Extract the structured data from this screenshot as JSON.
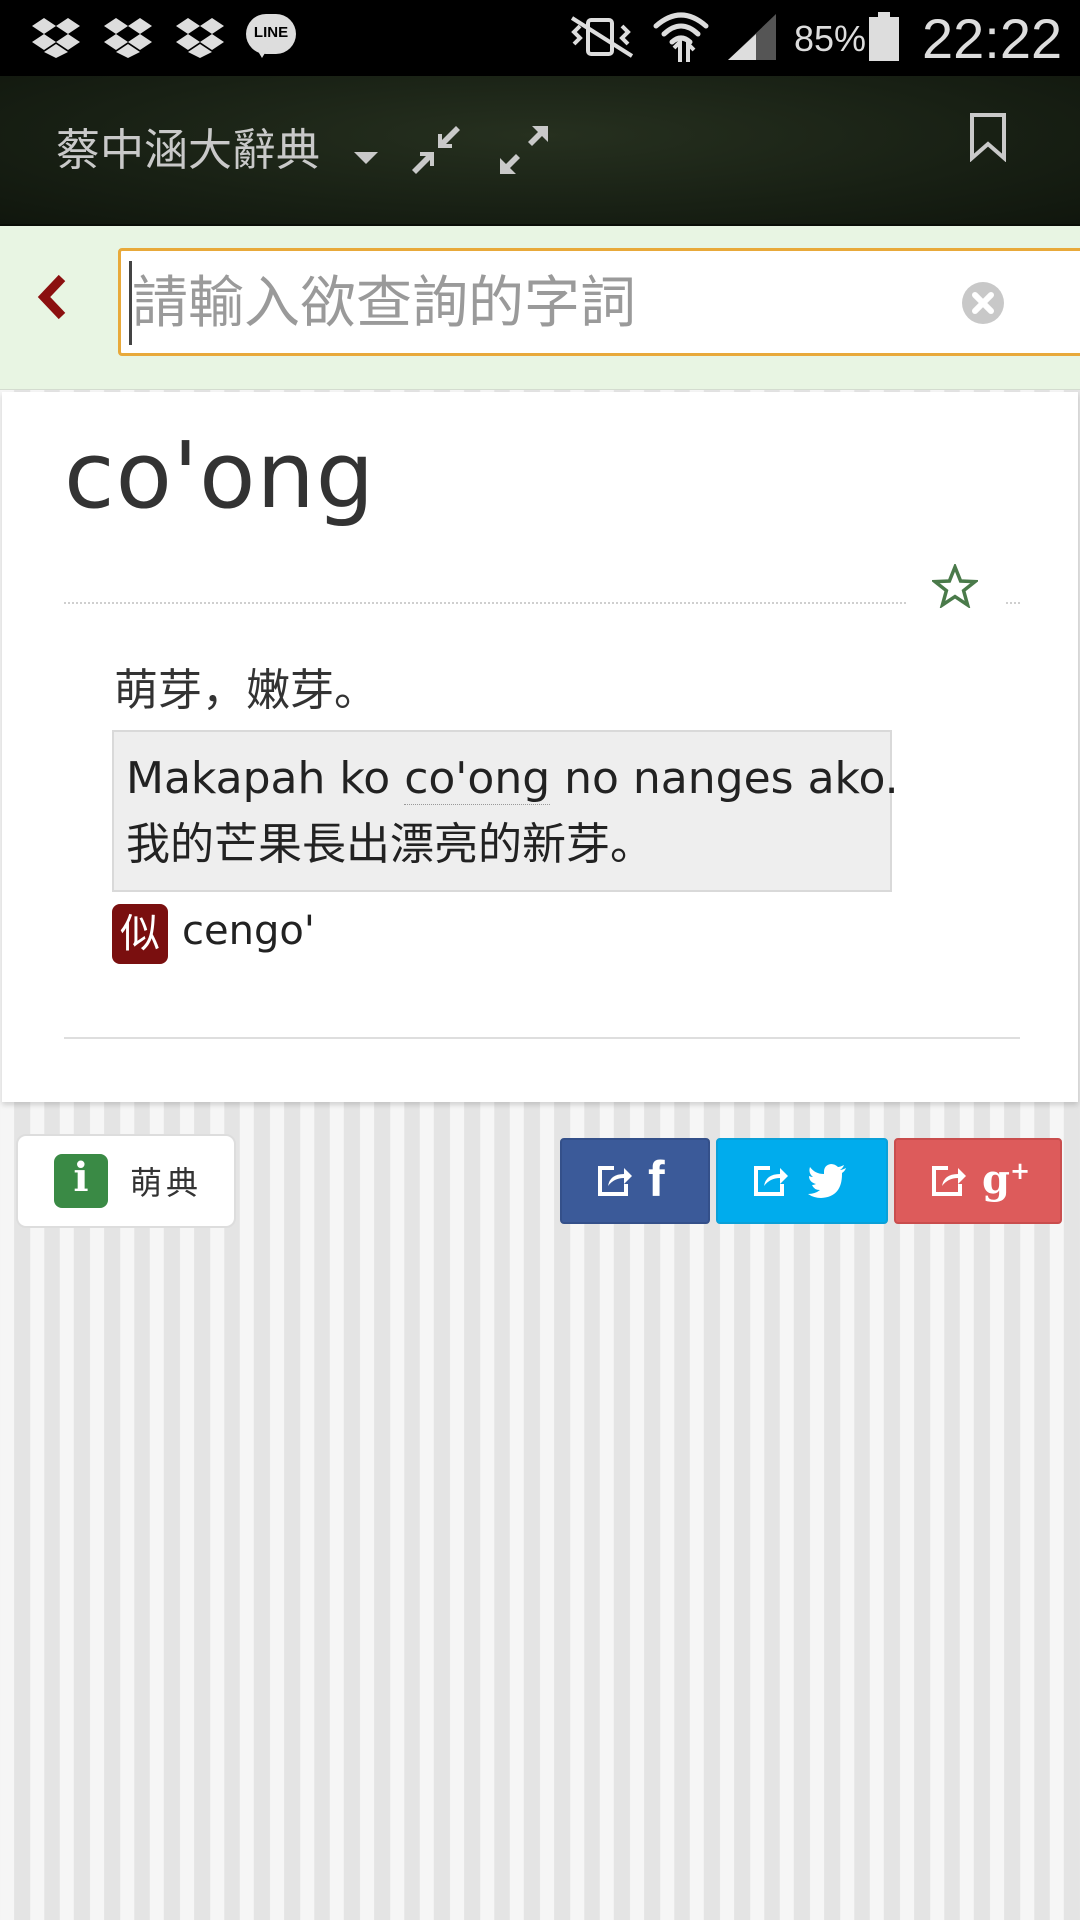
{
  "status_bar": {
    "battery_percent": "85%",
    "time": "22:22",
    "notification_icons": [
      "dropbox-icon",
      "dropbox-icon",
      "dropbox-icon",
      "line-icon"
    ],
    "line_label": "LINE"
  },
  "app_bar": {
    "title": "蔡中涵大辭典",
    "icons": [
      "dropdown-caret-icon",
      "compress-icon",
      "expand-icon",
      "bookmark-icon"
    ]
  },
  "search": {
    "placeholder": "請輸入欲查詢的字詞",
    "value": ""
  },
  "entry": {
    "headword": "co'ong",
    "definition": "萌芽，嫩芽。",
    "example": {
      "pre": "Makapah ko ",
      "highlight": "co'ong",
      "post": " no nanges ako.",
      "translation": "我的芒果長出漂亮的新芽。"
    },
    "synonym": {
      "badge": "似",
      "word": "cengo'"
    }
  },
  "footer": {
    "about_icon_letter": "i",
    "about_label": "萌典",
    "share": [
      "facebook",
      "twitter",
      "google-plus"
    ],
    "gp_label": "g",
    "gp_sup": "+",
    "fb_label": "f"
  },
  "colors": {
    "accent": "#e8a93a",
    "back_arrow": "#8b1010",
    "synonym_badge": "#7a0f0f",
    "facebook": "#3b5a99",
    "twitter": "#00aced",
    "google_plus": "#dd5b5b",
    "about_icon": "#3a8a45"
  }
}
